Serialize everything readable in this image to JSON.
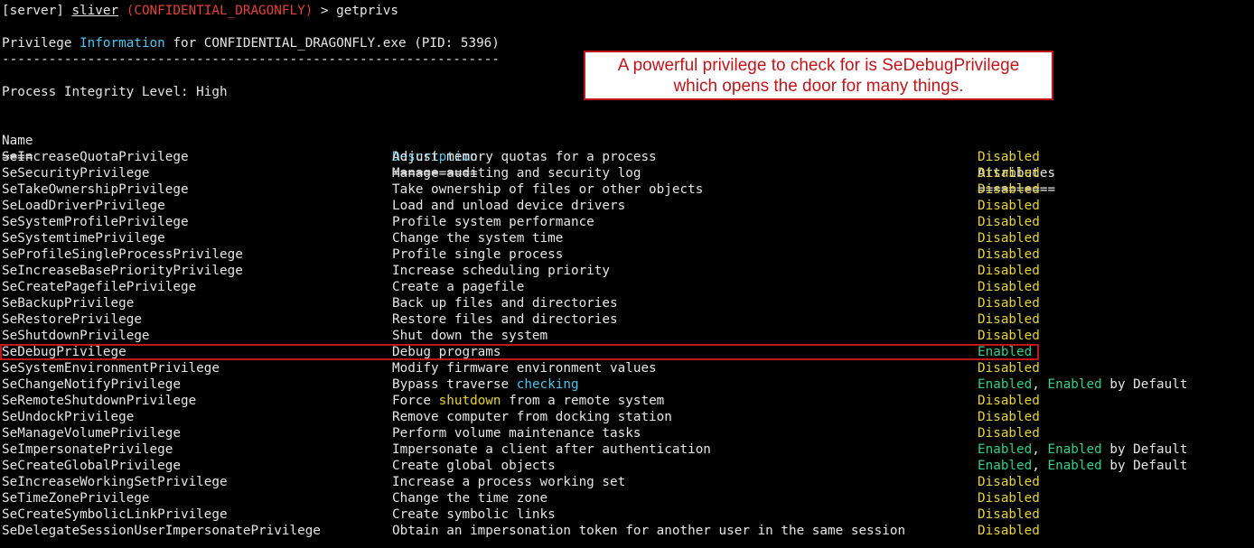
{
  "prompt": {
    "open": "[server] ",
    "session": "sliver",
    "target": "(CONFIDENTIAL_DRAGONFLY)",
    "arrow": " > ",
    "command": "getprivs"
  },
  "header": {
    "word1": "Privilege ",
    "word2": "Information",
    "rest": " for CONFIDENTIAL_DRAGONFLY.exe (PID: 5396)",
    "rule": "----------------------------------------------------------------"
  },
  "integrity": "Process Integrity Level: High",
  "columns": {
    "name": "Name",
    "description": "Description",
    "attributes": "Attributes",
    "name_rule": "====",
    "description_rule": "===========",
    "attributes_rule": "=========="
  },
  "rows": [
    {
      "name": "SeIncreaseQuotaPrivilege",
      "desc": "Adjust memory quotas for a process",
      "attr": "Disabled"
    },
    {
      "name": "SeSecurityPrivilege",
      "desc": "Manage auditing and security log",
      "attr": "Disabled"
    },
    {
      "name": "SeTakeOwnershipPrivilege",
      "desc": "Take ownership of files or other objects",
      "attr": "Disabled"
    },
    {
      "name": "SeLoadDriverPrivilege",
      "desc": "Load and unload device drivers",
      "attr": "Disabled"
    },
    {
      "name": "SeSystemProfilePrivilege",
      "desc": "Profile system performance",
      "attr": "Disabled"
    },
    {
      "name": "SeSystemtimePrivilege",
      "desc": "Change the system time",
      "attr": "Disabled"
    },
    {
      "name": "SeProfileSingleProcessPrivilege",
      "desc": "Profile single process",
      "attr": "Disabled"
    },
    {
      "name": "SeIncreaseBasePriorityPrivilege",
      "desc": "Increase scheduling priority",
      "attr": "Disabled"
    },
    {
      "name": "SeCreatePagefilePrivilege",
      "desc": "Create a pagefile",
      "attr": "Disabled"
    },
    {
      "name": "SeBackupPrivilege",
      "desc": "Back up files and directories",
      "attr": "Disabled"
    },
    {
      "name": "SeRestorePrivilege",
      "desc": "Restore files and directories",
      "attr": "Disabled"
    },
    {
      "name": "SeShutdownPrivilege",
      "desc": "Shut down the system",
      "attr": "Disabled"
    },
    {
      "name": "SeDebugPrivilege",
      "desc": "Debug programs",
      "attr": "Enabled"
    },
    {
      "name": "SeSystemEnvironmentPrivilege",
      "desc": "Modify firmware environment values",
      "attr": "Disabled"
    },
    {
      "name": "SeChangeNotifyPrivilege",
      "desc_pre": "Bypass traverse ",
      "desc_hl": "checking",
      "desc_post": "",
      "desc_hl_color": "cyan",
      "attr": "Enabled",
      "attr2": "Enabled",
      "attr_suffix": " by Default"
    },
    {
      "name": "SeRemoteShutdownPrivilege",
      "desc_pre": "Force ",
      "desc_hl": "shutdown",
      "desc_post": " from a remote system",
      "desc_hl_color": "yellow",
      "attr": "Disabled"
    },
    {
      "name": "SeUndockPrivilege",
      "desc": "Remove computer from docking station",
      "attr": "Disabled"
    },
    {
      "name": "SeManageVolumePrivilege",
      "desc": "Perform volume maintenance tasks",
      "attr": "Disabled"
    },
    {
      "name": "SeImpersonatePrivilege",
      "desc": "Impersonate a client after authentication",
      "attr": "Enabled",
      "attr2": "Enabled",
      "attr_suffix": " by Default"
    },
    {
      "name": "SeCreateGlobalPrivilege",
      "desc": "Create global objects",
      "attr": "Enabled",
      "attr2": "Enabled",
      "attr_suffix": " by Default"
    },
    {
      "name": "SeIncreaseWorkingSetPrivilege",
      "desc": "Increase a process working set",
      "attr": "Disabled"
    },
    {
      "name": "SeTimeZonePrivilege",
      "desc": "Change the time zone",
      "attr": "Disabled"
    },
    {
      "name": "SeCreateSymbolicLinkPrivilege",
      "desc": "Create symbolic links",
      "attr": "Disabled"
    },
    {
      "name": "SeDelegateSessionUserImpersonatePrivilege",
      "desc": "Obtain an impersonation token for another user in the same session",
      "attr": "Disabled"
    }
  ],
  "callout": {
    "line1": "A powerful privilege to check for is SeDebugPrivilege",
    "line2": "which opens the door for many things."
  },
  "colors": {
    "background": "#000000",
    "text": "#e6e6e6",
    "cyan": "#47c7ef",
    "yellow": "#e6d33a",
    "green": "#2fd18a",
    "red": "#e0433a",
    "annotation": "#c0161a"
  }
}
